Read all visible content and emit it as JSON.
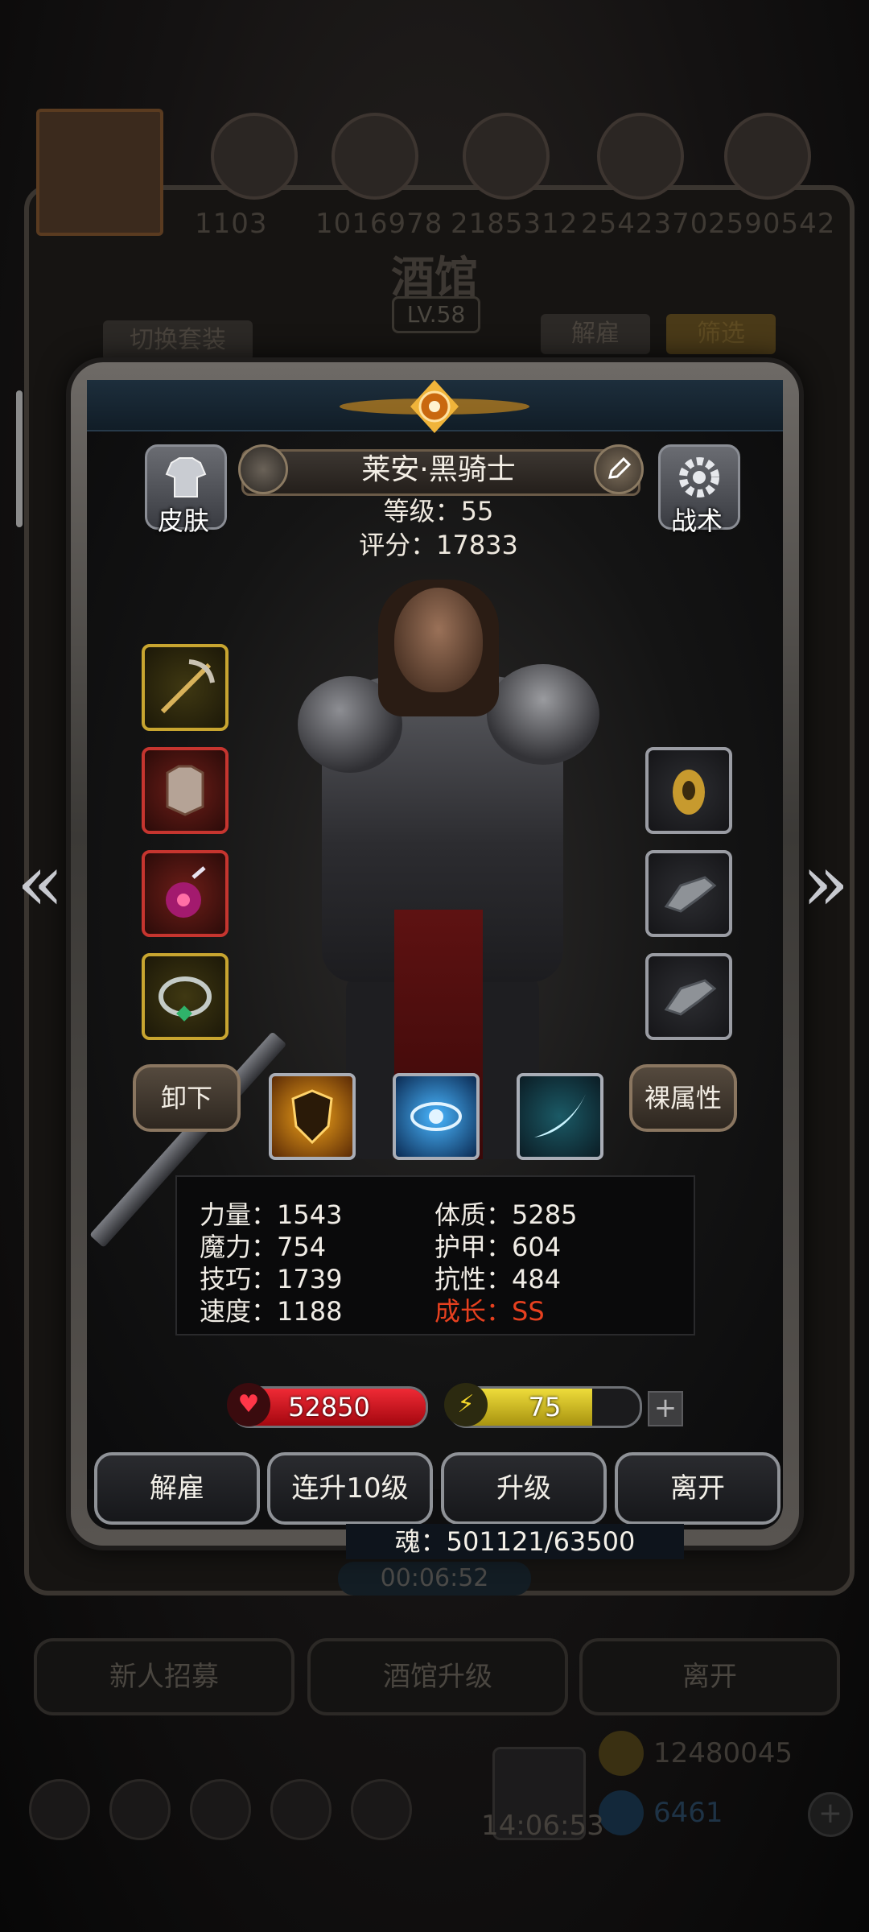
{
  "background": {
    "top_numbers": [
      "1103",
      "1016978",
      "2185312",
      "2542370",
      "2590542"
    ],
    "title": "酒馆",
    "level_badge": "LV.58",
    "switch_outfit_button": "切换套装",
    "dismiss_button": "解雇",
    "filter_button": "筛选",
    "timer": "00:06:52",
    "bottom_buttons": [
      "新人招募",
      "酒馆升级",
      "离开"
    ],
    "currency_gold": "12480045",
    "currency_gem": "6461",
    "clock": "14:06:53"
  },
  "hero": {
    "name": "莱安·黑骑士",
    "level_text": "等级：55",
    "score_text": "评分：17833",
    "skin_button": "皮肤",
    "tactics_button": "战术",
    "unequip_button": "卸下",
    "bare_attr_button": "裸属性",
    "stats": {
      "strength": "力量：1543",
      "magic": "魔力：754",
      "skill": "技巧：1739",
      "speed": "速度：1188",
      "constitution": "体质：5285",
      "armor": "护甲：604",
      "resistance": "抗性：484",
      "growth": "成长：SS"
    },
    "hp": "52850",
    "hp_fill": 1.0,
    "energy": "75",
    "energy_fill": 0.75,
    "actions": [
      "解雇",
      "连升10级",
      "升级",
      "离开"
    ],
    "soul": "魂：501121/63500"
  },
  "icons": {
    "left_slots": [
      "pickaxe-icon",
      "chest-armor-icon",
      "potion-icon",
      "ring-icon"
    ],
    "right_slots": [
      "amulet-icon",
      "gauntlet-icon",
      "gauntlet-icon"
    ],
    "skills": [
      "shield-skill-icon",
      "eye-skill-icon",
      "slash-skill-icon"
    ]
  },
  "colors": {
    "hp_red": "#d0121e",
    "energy_yellow": "#d9c31e",
    "growth_red": "#e6401f"
  }
}
